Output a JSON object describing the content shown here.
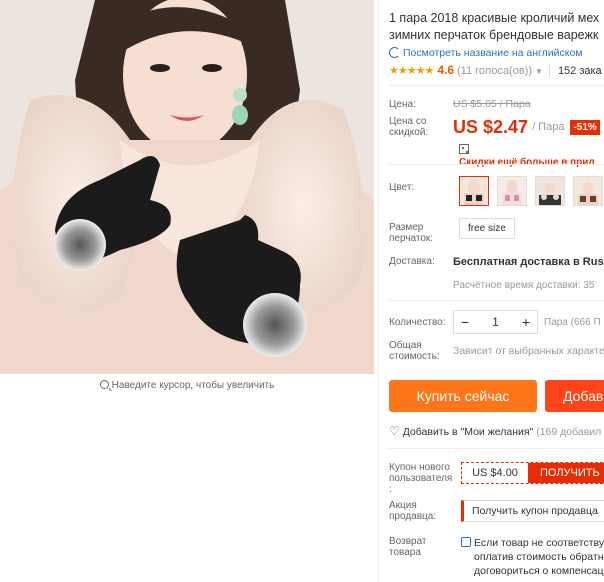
{
  "product": {
    "title_line1": "1 пара 2018 красивые кроличий мех",
    "title_line2": "зимних перчаток брендовые варежк",
    "translate_link": "Посмотреть название на английском",
    "rating_stars": "★★★★★",
    "rating_value": "4.6",
    "votes": "(11 голоса(ов))",
    "orders": "152 зака"
  },
  "gallery": {
    "zoom_hint": "Наведите курсор, чтобы увеличить"
  },
  "price": {
    "label": "Цена:",
    "old_value": "US $5.05 / Пара",
    "discount_label_1": "Цена со",
    "discount_label_2": "скидкой:",
    "new_value": "US $2.47",
    "unit": "/ Пара",
    "discount_badge": "-51%",
    "promo_text": "Скидки ещё больше в прил"
  },
  "color": {
    "label": "Цвет:"
  },
  "size": {
    "label_1": "Размер",
    "label_2": "перчаток:",
    "value": "free size"
  },
  "shipping": {
    "label": "Доставка:",
    "value": "Бесплатная доставка в Russia",
    "time": "Расчётное время доставки: 35"
  },
  "quantity": {
    "label": "Количество:",
    "minus": "−",
    "value": "1",
    "plus": "+",
    "available": "Пара (666 П"
  },
  "total": {
    "label_1": "Общая",
    "label_2": "стоимость:",
    "value": "Зависит от выбранных характе"
  },
  "actions": {
    "buy_now": "Купить сейчас",
    "add_to_cart": "Добав",
    "wishlist": "Добавить в \"Мои желания\"",
    "wishlist_count": "(169 добавил"
  },
  "coupons": {
    "new_user_label_1": "Купон нового",
    "new_user_label_2": "пользователя",
    "new_user_label_3": ":",
    "new_user_amount": "US $4.00",
    "get_button": "ПОЛУЧИТЬ",
    "seller_label_1": "Акция",
    "seller_label_2": "продавца:",
    "seller_value": "Получить купон продавца"
  },
  "returns": {
    "label_1": "Возврат",
    "label_2": "товара",
    "line1": "Если товар не соответству",
    "line2": "оплатив стоимость обратно",
    "line3": "договориться о компенсаци"
  },
  "colors": {
    "accent": "#e62e04",
    "buy": "#ff7519",
    "link": "#2e71b9",
    "star": "#f29e0c"
  }
}
